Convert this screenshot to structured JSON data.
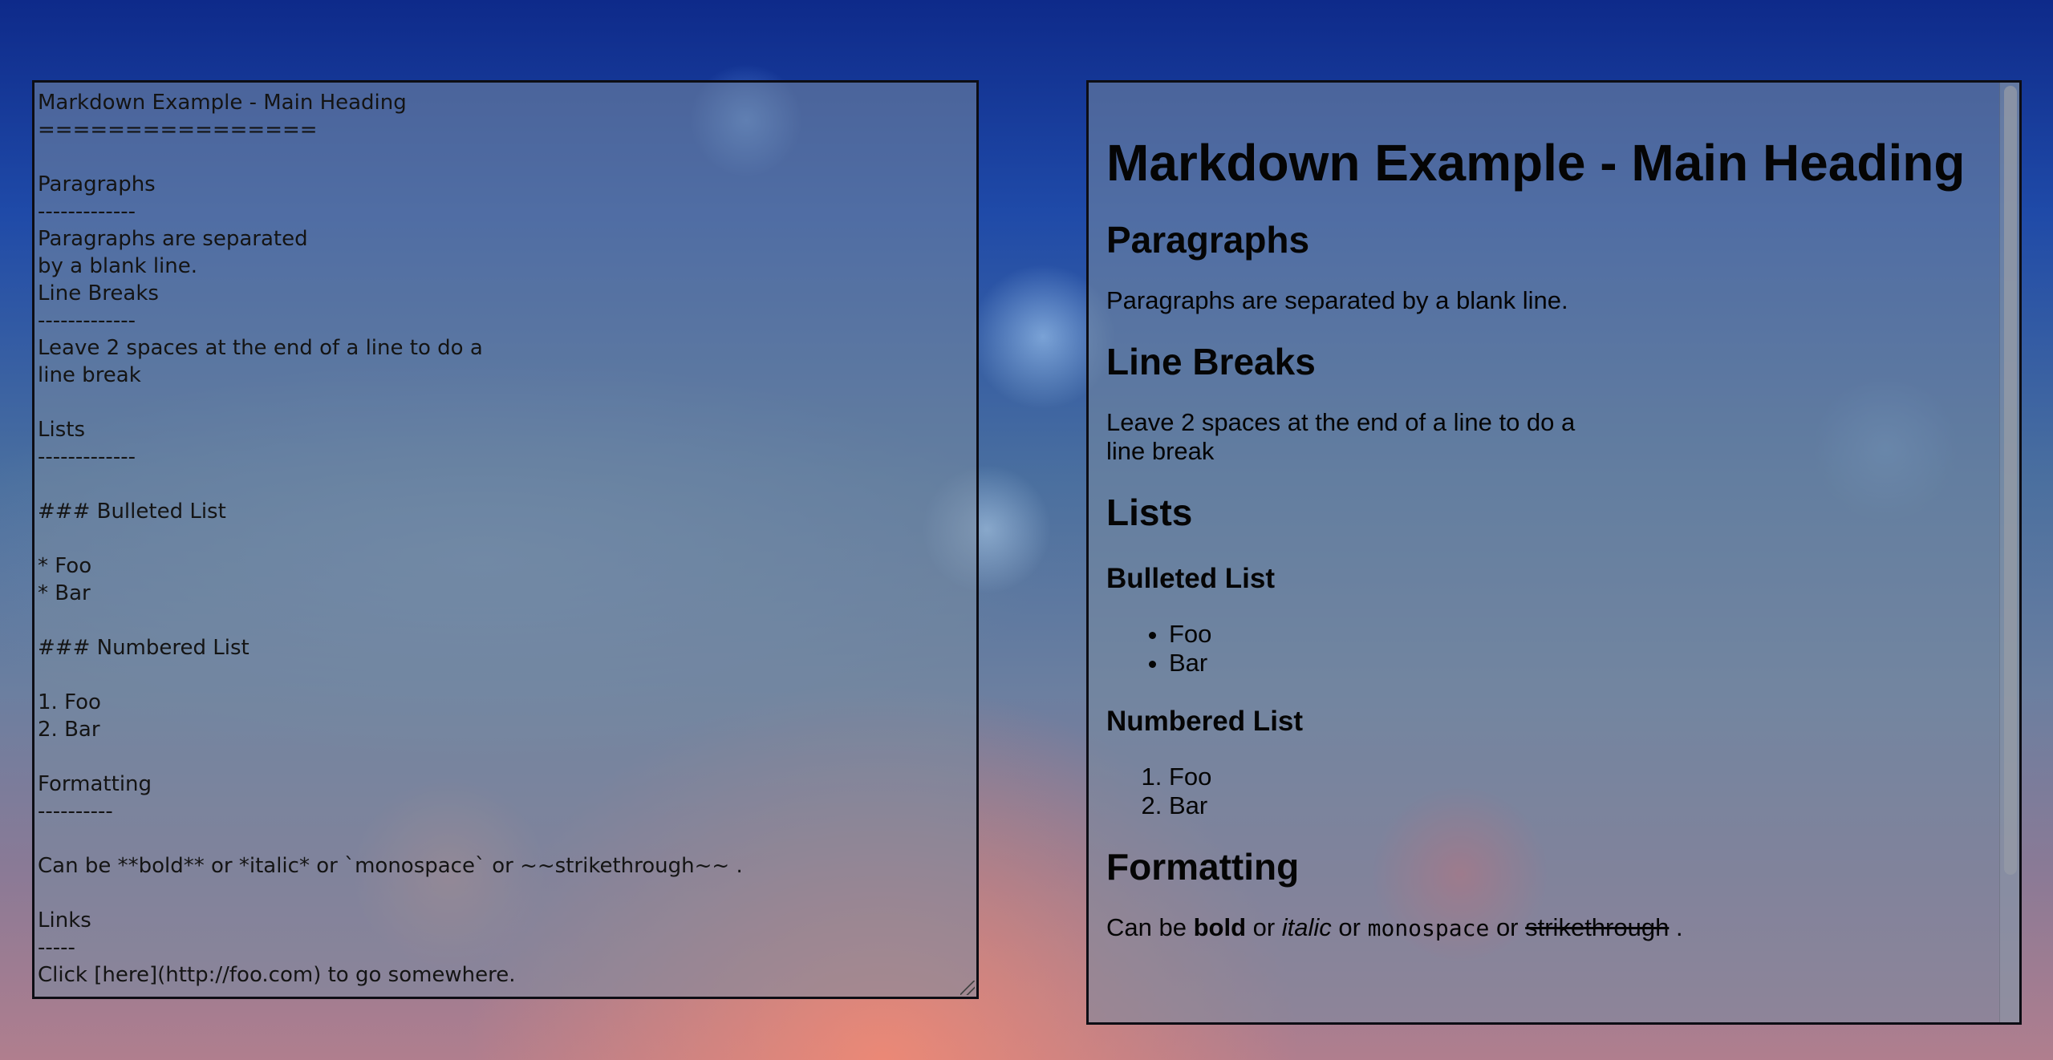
{
  "editor": {
    "source": "Markdown Example - Main Heading\n================\n\nParagraphs\n-------------\nParagraphs are separated\nby a blank line.\nLine Breaks\n-------------\nLeave 2 spaces at the end of a line to do a\nline break\n\nLists\n-------------\n\n### Bulleted List\n\n* Foo\n* Bar\n\n### Numbered List\n\n1. Foo\n2. Bar\n\nFormatting\n----------\n\nCan be **bold** or *italic* or `monospace` or ~~strikethrough~~ .\n\nLinks\n-----\nClick [here](http://foo.com) to go somewhere."
  },
  "preview": {
    "h1": "Markdown Example - Main Heading",
    "paragraphs_heading": "Paragraphs",
    "paragraphs_text": "Paragraphs are separated by a blank line.",
    "linebreaks_heading": "Line Breaks",
    "linebreaks_line1": "Leave 2 spaces at the end of a line to do a",
    "linebreaks_line2": "line break",
    "lists_heading": "Lists",
    "bulleted_heading": "Bulleted List",
    "bulleted_items": [
      "Foo",
      "Bar"
    ],
    "numbered_heading": "Numbered List",
    "numbered_items": [
      "Foo",
      "Bar"
    ],
    "formatting_heading": "Formatting",
    "formatting": {
      "prefix": "Can be ",
      "bold": "bold",
      "sep1": " or ",
      "italic": "italic",
      "sep2": " or ",
      "mono": "monospace",
      "sep3": " or ",
      "strike": "strikethrough",
      "suffix": " ."
    }
  }
}
